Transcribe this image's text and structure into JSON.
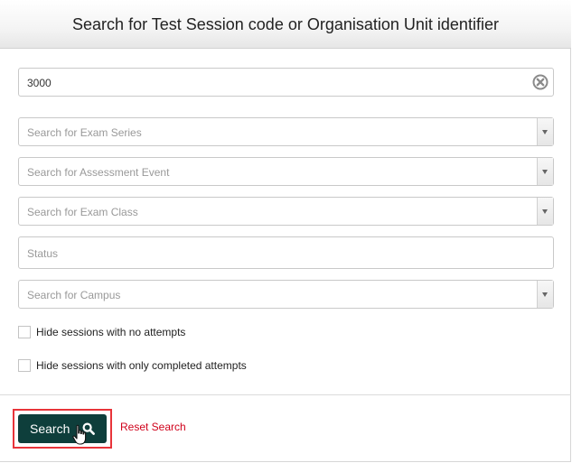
{
  "header": {
    "title": "Search for Test Session code or Organisation Unit identifier"
  },
  "search_input": {
    "value": "3000",
    "clear_icon": "clear-circle-icon"
  },
  "dropdowns": {
    "exam_series": {
      "placeholder": "Search for Exam Series"
    },
    "assessment_event": {
      "placeholder": "Search for Assessment Event"
    },
    "exam_class": {
      "placeholder": "Search for Exam Class"
    },
    "status": {
      "placeholder": "Status"
    },
    "campus": {
      "placeholder": "Search for Campus"
    }
  },
  "checkboxes": {
    "hide_no_attempts": {
      "label": "Hide sessions with no attempts",
      "checked": false
    },
    "hide_completed": {
      "label": "Hide sessions with only completed attempts",
      "checked": false
    }
  },
  "footer": {
    "search_label": "Search",
    "search_icon": "magnifier-icon",
    "reset_label": "Reset Search",
    "highlight_color": "#e8343a",
    "button_color": "#0e3e3b",
    "reset_color": "#d0021b"
  }
}
